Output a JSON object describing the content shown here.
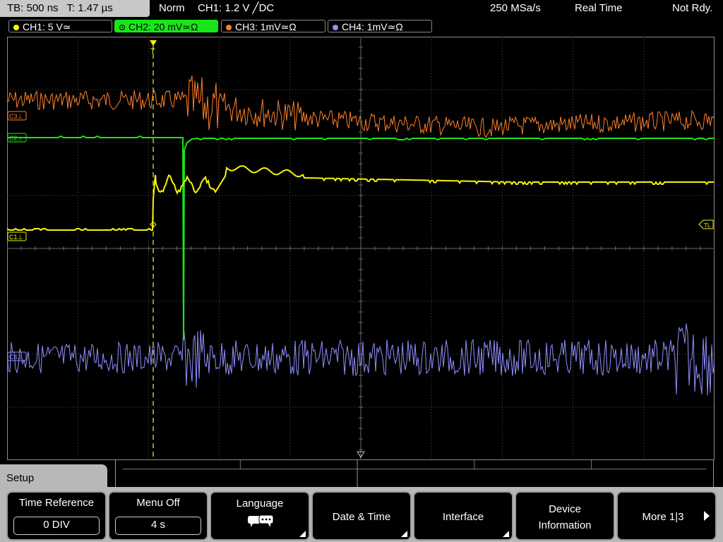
{
  "topbar": {
    "tb": "TB: 500 ns",
    "t": "T: 1.47 µs",
    "mode": "Norm",
    "trigger": "CH1: 1.2 V ╱DC",
    "rate": "250 MSa/s",
    "acq": "Real Time",
    "status": "Not Rdy."
  },
  "channels": [
    {
      "label": "CH1: 5 V≃",
      "color": "#f5f50a"
    },
    {
      "label": "CH2: 20 mV≃Ω",
      "color": "#19e619"
    },
    {
      "label": "CH3: 1mV≃Ω",
      "color": "#ff7f2a"
    },
    {
      "label": "CH4: 1mV≃Ω",
      "color": "#8f8fff"
    }
  ],
  "markers": {
    "c3": "C3⊥",
    "c2": "C2⊥",
    "c1": "C1⊥",
    "c4": "C4⊥",
    "tl": "TL",
    "trig": "T"
  },
  "menu": {
    "title": "Setup",
    "keys": [
      {
        "label": "Time Reference",
        "value": "0 DIV"
      },
      {
        "label": "Menu Off",
        "value": "4 s"
      },
      {
        "label": "Language",
        "icon": "speech-bubbles-icon"
      },
      {
        "label": "Date & Time"
      },
      {
        "label": "Interface"
      },
      {
        "label": "Device",
        "label2": "Information"
      },
      {
        "label": "More 1|3"
      }
    ]
  },
  "colors": {
    "grid": "#505050",
    "accent_green": "#19e619"
  }
}
